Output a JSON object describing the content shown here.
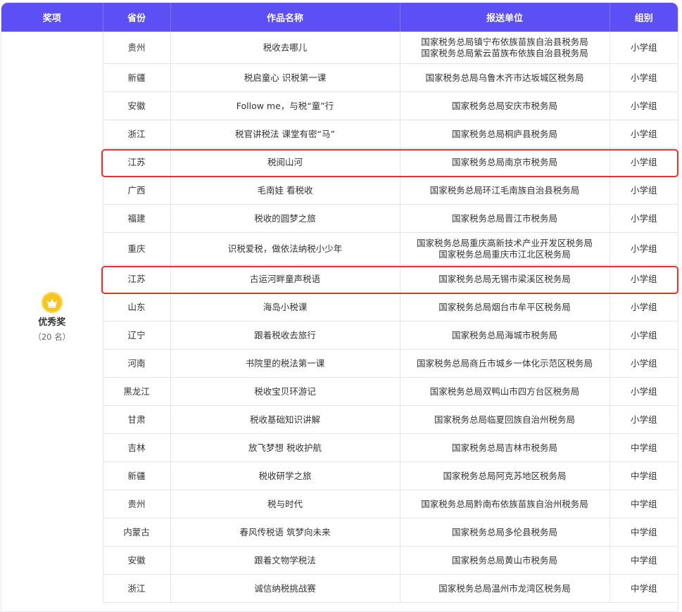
{
  "headers": {
    "award": "奖项",
    "province": "省份",
    "work": "作品名称",
    "unit": "报送单位",
    "group": "组别"
  },
  "award": {
    "name": "优秀奖",
    "count": "（20 名）",
    "icon": "crown-medal-icon",
    "icon_color": "#f7c520"
  },
  "colors": {
    "header_bg": "#5b4ff5",
    "highlight": "#e8312c"
  },
  "rows": [
    {
      "province": "贵州",
      "work": "税收去哪儿",
      "unit": [
        "国家税务总局镇宁布依族苗族自治县税务局",
        "国家税务总局紫云苗族布依族自治县税务局"
      ],
      "group": "小学组"
    },
    {
      "province": "新疆",
      "work": "税启童心 识税第一课",
      "unit": [
        "国家税务总局乌鲁木齐市达坂城区税务局"
      ],
      "group": "小学组"
    },
    {
      "province": "安徽",
      "work": "Follow me，与税“童”行",
      "unit": [
        "国家税务总局安庆市税务局"
      ],
      "group": "小学组"
    },
    {
      "province": "浙江",
      "work": "税官讲税法 课堂有密“马”",
      "unit": [
        "国家税务总局桐庐县税务局"
      ],
      "group": "小学组"
    },
    {
      "province": "江苏",
      "work": "税阅山河",
      "unit": [
        "国家税务总局南京市税务局"
      ],
      "group": "小学组",
      "highlighted": true
    },
    {
      "province": "广西",
      "work": "毛南娃 看税收",
      "unit": [
        "国家税务总局环江毛南族自治县税务局"
      ],
      "group": "小学组"
    },
    {
      "province": "福建",
      "work": "税收的圆梦之旅",
      "unit": [
        "国家税务总局晋江市税务局"
      ],
      "group": "小学组"
    },
    {
      "province": "重庆",
      "work": "识税爱税，做依法纳税小少年",
      "unit": [
        "国家税务总局重庆高新技术产业开发区税务局",
        "国家税务总局重庆市江北区税务局"
      ],
      "group": "小学组"
    },
    {
      "province": "江苏",
      "work": "古运河畔童声税语",
      "unit": [
        "国家税务总局无锡市梁溪区税务局"
      ],
      "group": "小学组",
      "highlighted": true
    },
    {
      "province": "山东",
      "work": "海岛小税课",
      "unit": [
        "国家税务总局烟台市牟平区税务局"
      ],
      "group": "小学组"
    },
    {
      "province": "辽宁",
      "work": "跟着税收去旅行",
      "unit": [
        "国家税务总局海城市税务局"
      ],
      "group": "小学组"
    },
    {
      "province": "河南",
      "work": "书院里的税法第一课",
      "unit": [
        "国家税务总局商丘市城乡一体化示范区税务局"
      ],
      "group": "小学组"
    },
    {
      "province": "黑龙江",
      "work": "税收宝贝环游记",
      "unit": [
        "国家税务总局双鸭山市四方台区税务局"
      ],
      "group": "小学组"
    },
    {
      "province": "甘肃",
      "work": "税收基础知识讲解",
      "unit": [
        "国家税务总局临夏回族自治州税务局"
      ],
      "group": "小学组"
    },
    {
      "province": "吉林",
      "work": "放飞梦想 税收护航",
      "unit": [
        "国家税务总局吉林市税务局"
      ],
      "group": "中学组"
    },
    {
      "province": "新疆",
      "work": "税收研学之旅",
      "unit": [
        "国家税务总局阿克苏地区税务局"
      ],
      "group": "中学组"
    },
    {
      "province": "贵州",
      "work": "税与时代",
      "unit": [
        "国家税务总局黔南布依族苗族自治州税务局"
      ],
      "group": "中学组"
    },
    {
      "province": "内蒙古",
      "work": "春风传税语 筑梦向未来",
      "unit": [
        "国家税务总局多伦县税务局"
      ],
      "group": "中学组"
    },
    {
      "province": "安徽",
      "work": "跟着文物学税法",
      "unit": [
        "国家税务总局黄山市税务局"
      ],
      "group": "中学组"
    },
    {
      "province": "浙江",
      "work": "诚信纳税挑战赛",
      "unit": [
        "国家税务总局温州市龙湾区税务局"
      ],
      "group": "中学组"
    }
  ]
}
